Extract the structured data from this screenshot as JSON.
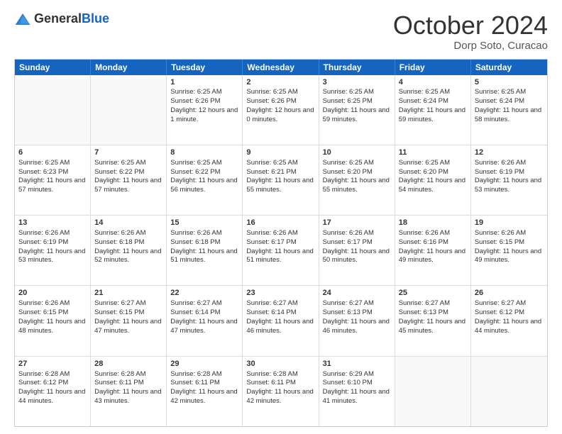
{
  "header": {
    "logo_general": "General",
    "logo_blue": "Blue",
    "month": "October 2024",
    "location": "Dorp Soto, Curacao"
  },
  "days": [
    "Sunday",
    "Monday",
    "Tuesday",
    "Wednesday",
    "Thursday",
    "Friday",
    "Saturday"
  ],
  "rows": [
    [
      {
        "day": "",
        "empty": true
      },
      {
        "day": "",
        "empty": true
      },
      {
        "day": "1",
        "sunrise": "Sunrise: 6:25 AM",
        "sunset": "Sunset: 6:26 PM",
        "daylight": "Daylight: 12 hours and 1 minute."
      },
      {
        "day": "2",
        "sunrise": "Sunrise: 6:25 AM",
        "sunset": "Sunset: 6:26 PM",
        "daylight": "Daylight: 12 hours and 0 minutes."
      },
      {
        "day": "3",
        "sunrise": "Sunrise: 6:25 AM",
        "sunset": "Sunset: 6:25 PM",
        "daylight": "Daylight: 11 hours and 59 minutes."
      },
      {
        "day": "4",
        "sunrise": "Sunrise: 6:25 AM",
        "sunset": "Sunset: 6:24 PM",
        "daylight": "Daylight: 11 hours and 59 minutes."
      },
      {
        "day": "5",
        "sunrise": "Sunrise: 6:25 AM",
        "sunset": "Sunset: 6:24 PM",
        "daylight": "Daylight: 11 hours and 58 minutes."
      }
    ],
    [
      {
        "day": "6",
        "sunrise": "Sunrise: 6:25 AM",
        "sunset": "Sunset: 6:23 PM",
        "daylight": "Daylight: 11 hours and 57 minutes."
      },
      {
        "day": "7",
        "sunrise": "Sunrise: 6:25 AM",
        "sunset": "Sunset: 6:22 PM",
        "daylight": "Daylight: 11 hours and 57 minutes."
      },
      {
        "day": "8",
        "sunrise": "Sunrise: 6:25 AM",
        "sunset": "Sunset: 6:22 PM",
        "daylight": "Daylight: 11 hours and 56 minutes."
      },
      {
        "day": "9",
        "sunrise": "Sunrise: 6:25 AM",
        "sunset": "Sunset: 6:21 PM",
        "daylight": "Daylight: 11 hours and 55 minutes."
      },
      {
        "day": "10",
        "sunrise": "Sunrise: 6:25 AM",
        "sunset": "Sunset: 6:20 PM",
        "daylight": "Daylight: 11 hours and 55 minutes."
      },
      {
        "day": "11",
        "sunrise": "Sunrise: 6:25 AM",
        "sunset": "Sunset: 6:20 PM",
        "daylight": "Daylight: 11 hours and 54 minutes."
      },
      {
        "day": "12",
        "sunrise": "Sunrise: 6:26 AM",
        "sunset": "Sunset: 6:19 PM",
        "daylight": "Daylight: 11 hours and 53 minutes."
      }
    ],
    [
      {
        "day": "13",
        "sunrise": "Sunrise: 6:26 AM",
        "sunset": "Sunset: 6:19 PM",
        "daylight": "Daylight: 11 hours and 53 minutes."
      },
      {
        "day": "14",
        "sunrise": "Sunrise: 6:26 AM",
        "sunset": "Sunset: 6:18 PM",
        "daylight": "Daylight: 11 hours and 52 minutes."
      },
      {
        "day": "15",
        "sunrise": "Sunrise: 6:26 AM",
        "sunset": "Sunset: 6:18 PM",
        "daylight": "Daylight: 11 hours and 51 minutes."
      },
      {
        "day": "16",
        "sunrise": "Sunrise: 6:26 AM",
        "sunset": "Sunset: 6:17 PM",
        "daylight": "Daylight: 11 hours and 51 minutes."
      },
      {
        "day": "17",
        "sunrise": "Sunrise: 6:26 AM",
        "sunset": "Sunset: 6:17 PM",
        "daylight": "Daylight: 11 hours and 50 minutes."
      },
      {
        "day": "18",
        "sunrise": "Sunrise: 6:26 AM",
        "sunset": "Sunset: 6:16 PM",
        "daylight": "Daylight: 11 hours and 49 minutes."
      },
      {
        "day": "19",
        "sunrise": "Sunrise: 6:26 AM",
        "sunset": "Sunset: 6:15 PM",
        "daylight": "Daylight: 11 hours and 49 minutes."
      }
    ],
    [
      {
        "day": "20",
        "sunrise": "Sunrise: 6:26 AM",
        "sunset": "Sunset: 6:15 PM",
        "daylight": "Daylight: 11 hours and 48 minutes."
      },
      {
        "day": "21",
        "sunrise": "Sunrise: 6:27 AM",
        "sunset": "Sunset: 6:15 PM",
        "daylight": "Daylight: 11 hours and 47 minutes."
      },
      {
        "day": "22",
        "sunrise": "Sunrise: 6:27 AM",
        "sunset": "Sunset: 6:14 PM",
        "daylight": "Daylight: 11 hours and 47 minutes."
      },
      {
        "day": "23",
        "sunrise": "Sunrise: 6:27 AM",
        "sunset": "Sunset: 6:14 PM",
        "daylight": "Daylight: 11 hours and 46 minutes."
      },
      {
        "day": "24",
        "sunrise": "Sunrise: 6:27 AM",
        "sunset": "Sunset: 6:13 PM",
        "daylight": "Daylight: 11 hours and 46 minutes."
      },
      {
        "day": "25",
        "sunrise": "Sunrise: 6:27 AM",
        "sunset": "Sunset: 6:13 PM",
        "daylight": "Daylight: 11 hours and 45 minutes."
      },
      {
        "day": "26",
        "sunrise": "Sunrise: 6:27 AM",
        "sunset": "Sunset: 6:12 PM",
        "daylight": "Daylight: 11 hours and 44 minutes."
      }
    ],
    [
      {
        "day": "27",
        "sunrise": "Sunrise: 6:28 AM",
        "sunset": "Sunset: 6:12 PM",
        "daylight": "Daylight: 11 hours and 44 minutes."
      },
      {
        "day": "28",
        "sunrise": "Sunrise: 6:28 AM",
        "sunset": "Sunset: 6:11 PM",
        "daylight": "Daylight: 11 hours and 43 minutes."
      },
      {
        "day": "29",
        "sunrise": "Sunrise: 6:28 AM",
        "sunset": "Sunset: 6:11 PM",
        "daylight": "Daylight: 11 hours and 42 minutes."
      },
      {
        "day": "30",
        "sunrise": "Sunrise: 6:28 AM",
        "sunset": "Sunset: 6:11 PM",
        "daylight": "Daylight: 11 hours and 42 minutes."
      },
      {
        "day": "31",
        "sunrise": "Sunrise: 6:29 AM",
        "sunset": "Sunset: 6:10 PM",
        "daylight": "Daylight: 11 hours and 41 minutes."
      },
      {
        "day": "",
        "empty": true
      },
      {
        "day": "",
        "empty": true
      }
    ]
  ]
}
